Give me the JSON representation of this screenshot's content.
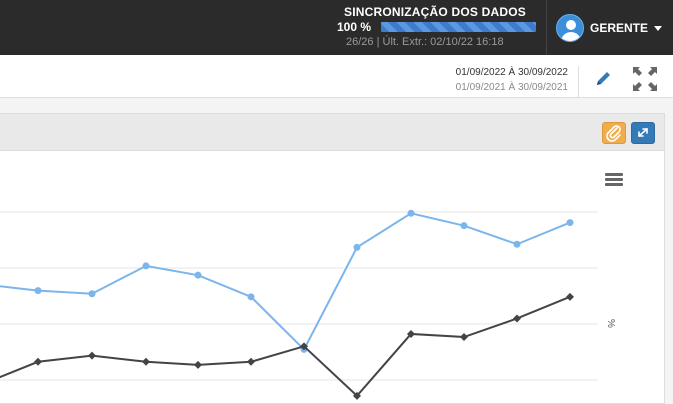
{
  "topbar": {
    "sync_title": "SINCRONIZAÇÃO DOS DADOS",
    "sync_percent_label": "100 %",
    "sync_progress": 1.0,
    "sync_subtitle": "26/26 | Últ. Extr.: 02/10/22 16:18",
    "user_name": "GERENTE"
  },
  "toolbar": {
    "date_range": "01/09/2022 À 30/09/2022",
    "compare_range": "01/09/2021 À 30/09/2021"
  },
  "panel": {
    "axis_label": "%"
  },
  "colors": {
    "topbar_bg": "#2b2b2b",
    "series_current": "#7cb5ec",
    "series_previous": "#434348",
    "clip_button": "#f0ad4e",
    "fullscreen_button": "#337ab7"
  },
  "icons": {
    "user": "user-avatar-icon",
    "edit": "pencil-icon",
    "expand": "expand-arrows-icon",
    "clip": "paperclip-icon",
    "fullscreen": "fullscreen-icon",
    "menu": "hamburger-menu-icon"
  },
  "chart_data": {
    "type": "line",
    "grid": true,
    "series": [
      {
        "values": [
          23,
          21,
          20,
          29,
          26,
          19,
          2,
          35,
          46,
          42,
          36,
          43
        ],
        "color": "#7cb5ec"
      },
      {
        "values": [
          -9,
          -2,
          0,
          -2,
          -3,
          -2,
          3,
          -13,
          7,
          6,
          12,
          19
        ],
        "color": "#434348"
      }
    ],
    "ylim": [
      -15,
      60
    ]
  }
}
